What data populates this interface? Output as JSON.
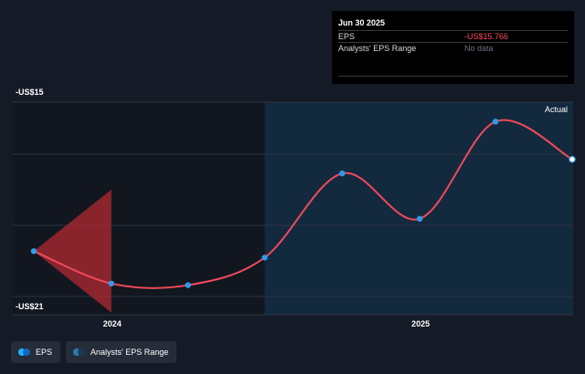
{
  "tooltip": {
    "date": "Jun 30 2025",
    "rows": [
      {
        "label": "EPS",
        "value": "-US$15.766"
      },
      {
        "label": "Analysts' EPS Range",
        "value": "No data"
      }
    ]
  },
  "legend": {
    "items": [
      {
        "label": "EPS",
        "color_a": "#1fb4ff",
        "color_b": "#1565c0"
      },
      {
        "label": "Analysts' EPS Range",
        "color_a": "#2b7bb5",
        "color_b": "#1e3a56"
      }
    ]
  },
  "colors": {
    "background": "#151b26",
    "past_region": "#11161f",
    "future_region": "#13293e",
    "line": "#f04a5a",
    "point": "#2f9bea",
    "range_fill": "#b22a33",
    "grid": "#2c3442"
  },
  "chart_data": {
    "type": "line",
    "title": "",
    "xlabel": "",
    "ylabel": "",
    "x_tick_labels": [
      "2024",
      "2025"
    ],
    "y_tick_labels": [
      "-US$15",
      "-US$21"
    ],
    "ylim": [
      -21,
      -15
    ],
    "x_range": [
      "2023-09-30",
      "2025-06-30"
    ],
    "region_label": "Actual",
    "region_start": "2024-06-30",
    "series": [
      {
        "name": "EPS",
        "points": [
          {
            "x": "2023-09-30",
            "y": -19.6
          },
          {
            "x": "2023-12-31",
            "y": -20.6
          },
          {
            "x": "2024-03-31",
            "y": -20.65
          },
          {
            "x": "2024-06-30",
            "y": -19.8
          },
          {
            "x": "2024-09-30",
            "y": -17.2
          },
          {
            "x": "2024-12-31",
            "y": -18.6
          },
          {
            "x": "2025-03-31",
            "y": -15.6
          },
          {
            "x": "2025-06-30",
            "y": -16.766
          }
        ]
      }
    ],
    "range_band": {
      "x_start": "2023-09-30",
      "x_end": "2023-12-31",
      "y_start": -19.6,
      "y_low": -21.5,
      "y_high": -17.7
    }
  }
}
